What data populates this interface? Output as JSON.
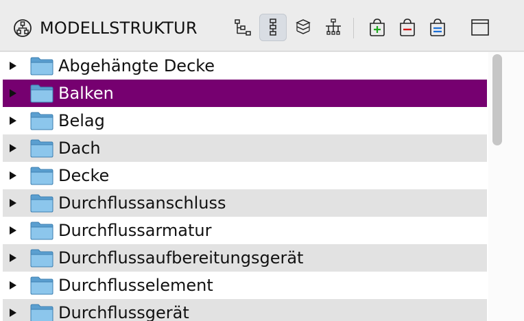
{
  "header": {
    "title": "MODELLSTRUKTUR",
    "title_icon": "hierarchy-icon",
    "toolbar": [
      {
        "name": "tree-view-icon",
        "pressed": false
      },
      {
        "name": "list-tree-icon",
        "pressed": true
      },
      {
        "name": "layers-tree-icon",
        "pressed": false
      },
      {
        "name": "network-tree-icon",
        "pressed": false
      },
      {
        "name": "add-bag-icon",
        "pressed": false
      },
      {
        "name": "remove-bag-icon",
        "pressed": false
      },
      {
        "name": "equal-bag-icon",
        "pressed": false
      },
      {
        "name": "window-icon",
        "pressed": false
      }
    ]
  },
  "tree": {
    "items": [
      {
        "label": "Abgehängte Decke",
        "selected": false
      },
      {
        "label": "Balken",
        "selected": true
      },
      {
        "label": "Belag",
        "selected": false
      },
      {
        "label": "Dach",
        "selected": false
      },
      {
        "label": "Decke",
        "selected": false
      },
      {
        "label": "Durchflussanschluss",
        "selected": false
      },
      {
        "label": "Durchflussarmatur",
        "selected": false
      },
      {
        "label": "Durchflussaufbereitungsgerät",
        "selected": false
      },
      {
        "label": "Durchflusselement",
        "selected": false
      },
      {
        "label": "Durchflussgerät",
        "selected": false
      }
    ]
  },
  "colors": {
    "selection": "#760070",
    "folder": "#6fb0dc",
    "stripe": "#e2e2e2"
  }
}
